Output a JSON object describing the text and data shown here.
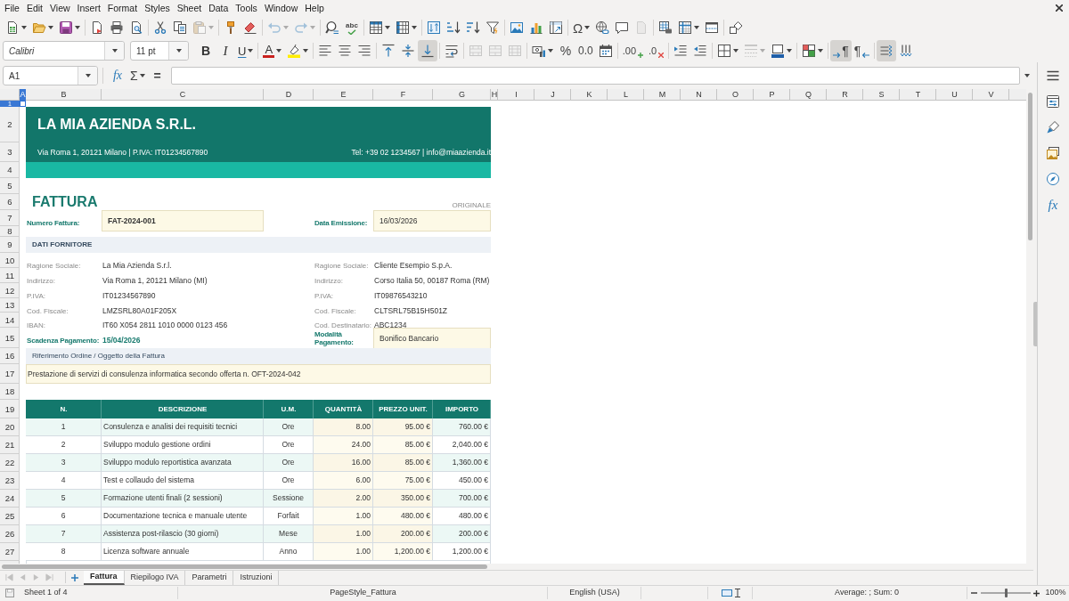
{
  "menu_bar": {
    "items": [
      "File",
      "Edit",
      "View",
      "Insert",
      "Format",
      "Styles",
      "Sheet",
      "Data",
      "Tools",
      "Window",
      "Help"
    ]
  },
  "standard_toolbar": [
    [
      {
        "kind": "new",
        "disabled": false
      },
      {
        "kind": "open",
        "disabled": false
      },
      {
        "kind": "save",
        "disabled": false
      }
    ],
    [
      {
        "kind": "export_pdf",
        "disabled": false
      },
      {
        "kind": "print",
        "disabled": false
      },
      {
        "kind": "print_preview",
        "disabled": false
      }
    ],
    [
      {
        "kind": "cut",
        "disabled": false
      },
      {
        "kind": "copy",
        "disabled": false
      },
      {
        "kind": "paste",
        "disabled": true
      }
    ],
    [
      {
        "kind": "clone_formatting",
        "disabled": false
      },
      {
        "kind": "clear_formatting",
        "disabled": false
      }
    ],
    [
      {
        "kind": "undo",
        "disabled": true
      },
      {
        "kind": "redo",
        "disabled": true
      }
    ],
    [
      {
        "kind": "find_replace",
        "disabled": false
      },
      {
        "kind": "spelling",
        "label": "abc",
        "disabled": false
      }
    ],
    [
      {
        "kind": "rows",
        "disabled": false
      },
      {
        "kind": "columns",
        "disabled": false
      }
    ],
    [
      {
        "kind": "sort",
        "disabled": false
      },
      {
        "kind": "sort_ascending",
        "disabled": false
      },
      {
        "kind": "sort_descending",
        "disabled": false
      },
      {
        "kind": "autofilter",
        "disabled": false
      }
    ],
    [
      {
        "kind": "image",
        "disabled": false
      },
      {
        "kind": "chart",
        "disabled": false
      },
      {
        "kind": "pivot_table",
        "disabled": false
      }
    ],
    [
      {
        "kind": "special_character",
        "label": "Ω",
        "disabled": false
      },
      {
        "kind": "hyperlink",
        "disabled": false
      },
      {
        "kind": "comment",
        "disabled": false
      },
      {
        "kind": "header_footer",
        "disabled": true
      }
    ],
    [
      {
        "kind": "print_area",
        "disabled": false
      },
      {
        "kind": "freeze",
        "disabled": false
      },
      {
        "kind": "split_window",
        "disabled": false
      }
    ],
    [
      {
        "kind": "draw_functions",
        "disabled": false
      }
    ]
  ],
  "formatting_toolbar": {
    "font_name": "Calibri",
    "font_size": "11 pt",
    "groups": [
      [
        {
          "kind": "bold",
          "label": "B",
          "pressed": false,
          "disabled": false
        },
        {
          "kind": "italic",
          "label": "I",
          "pressed": false,
          "disabled": false
        },
        {
          "kind": "underline",
          "label": "U",
          "pressed": false,
          "disabled": false
        }
      ],
      [
        {
          "kind": "font_color",
          "label": "A",
          "pressed": false,
          "disabled": false
        },
        {
          "kind": "highlight",
          "pressed": false,
          "disabled": false
        }
      ],
      [
        {
          "kind": "align_left",
          "pressed": false,
          "disabled": false
        },
        {
          "kind": "align_center",
          "pressed": false,
          "disabled": false
        },
        {
          "kind": "align_right",
          "pressed": false,
          "disabled": false
        }
      ],
      [
        {
          "kind": "align_top",
          "pressed": false,
          "disabled": false
        },
        {
          "kind": "align_middle",
          "pressed": false,
          "disabled": false
        },
        {
          "kind": "align_bottom",
          "pressed": true,
          "disabled": false
        }
      ],
      [
        {
          "kind": "wrap_text",
          "pressed": false,
          "disabled": false
        }
      ],
      [
        {
          "kind": "merge_center",
          "pressed": false,
          "disabled": true
        },
        {
          "kind": "merge",
          "pressed": false,
          "disabled": true
        },
        {
          "kind": "unmerge",
          "pressed": false,
          "disabled": true
        }
      ],
      [
        {
          "kind": "currency",
          "pressed": false,
          "disabled": false
        },
        {
          "kind": "percent",
          "label": "%",
          "pressed": false,
          "disabled": false
        },
        {
          "kind": "number",
          "label": "0.0",
          "pressed": false,
          "disabled": false
        },
        {
          "kind": "date",
          "pressed": false,
          "disabled": false
        }
      ],
      [
        {
          "kind": "add_decimal",
          "label": ".00",
          "pressed": false,
          "disabled": false
        },
        {
          "kind": "delete_decimal",
          "label": ".0",
          "pressed": false,
          "disabled": false
        }
      ],
      [
        {
          "kind": "indent_increase",
          "pressed": false,
          "disabled": false
        },
        {
          "kind": "indent_decrease",
          "pressed": false,
          "disabled": false
        }
      ],
      [
        {
          "kind": "borders",
          "pressed": false,
          "disabled": false
        },
        {
          "kind": "border_style",
          "pressed": false,
          "disabled": true
        },
        {
          "kind": "border_color",
          "pressed": false,
          "disabled": false
        }
      ],
      [
        {
          "kind": "conditional",
          "pressed": false,
          "disabled": false
        }
      ],
      [
        {
          "kind": "ltr",
          "label": "¶",
          "pressed": true,
          "disabled": false
        },
        {
          "kind": "rtl",
          "label": "¶",
          "pressed": false,
          "disabled": false
        }
      ],
      [
        {
          "kind": "text_horizontal",
          "pressed": true,
          "disabled": false
        },
        {
          "kind": "text_vertical",
          "pressed": false,
          "disabled": false
        }
      ]
    ]
  },
  "formula_bar": {
    "name_box": "A1",
    "buttons": [
      {
        "kind": "function_wizard",
        "label": "fx"
      },
      {
        "kind": "sum",
        "label": "Σ"
      },
      {
        "kind": "formula",
        "label": "="
      }
    ]
  },
  "sidebar": {
    "buttons": [
      {
        "kind": "menu"
      },
      {
        "kind": "properties"
      },
      {
        "kind": "styles"
      },
      {
        "kind": "gallery"
      },
      {
        "kind": "navigator"
      },
      {
        "kind": "functions",
        "label": "fx"
      }
    ]
  },
  "sheet": {
    "columns": [
      {
        "label": "A",
        "selected": true
      },
      {
        "label": "B",
        "selected": false
      },
      {
        "label": "C",
        "selected": false
      },
      {
        "label": "D",
        "selected": false
      },
      {
        "label": "E",
        "selected": false
      },
      {
        "label": "F",
        "selected": false
      },
      {
        "label": "G",
        "selected": false
      },
      {
        "label": "H",
        "selected": false
      },
      {
        "label": "I",
        "selected": false
      },
      {
        "label": "J",
        "selected": false
      },
      {
        "label": "K",
        "selected": false
      },
      {
        "label": "L",
        "selected": false
      },
      {
        "label": "M",
        "selected": false
      },
      {
        "label": "N",
        "selected": false
      },
      {
        "label": "O",
        "selected": false
      },
      {
        "label": "P",
        "selected": false
      },
      {
        "label": "Q",
        "selected": false
      },
      {
        "label": "R",
        "selected": false
      },
      {
        "label": "S",
        "selected": false
      },
      {
        "label": "T",
        "selected": false
      },
      {
        "label": "U",
        "selected": false
      },
      {
        "label": "V",
        "selected": false
      }
    ],
    "rows": [
      {
        "label": "1",
        "selected": true
      },
      {
        "label": "2",
        "selected": false
      },
      {
        "label": "3",
        "selected": false
      },
      {
        "label": "4",
        "selected": false
      },
      {
        "label": "5",
        "selected": false
      },
      {
        "label": "6",
        "selected": false
      },
      {
        "label": "7",
        "selected": false
      },
      {
        "label": "8",
        "selected": false
      },
      {
        "label": "9",
        "selected": false
      },
      {
        "label": "10",
        "selected": false
      },
      {
        "label": "11",
        "selected": false
      },
      {
        "label": "12",
        "selected": false
      },
      {
        "label": "13",
        "selected": false
      },
      {
        "label": "14",
        "selected": false
      },
      {
        "label": "15",
        "selected": false
      },
      {
        "label": "16",
        "selected": false
      },
      {
        "label": "17",
        "selected": false
      },
      {
        "label": "18",
        "selected": false
      },
      {
        "label": "19",
        "selected": false
      },
      {
        "label": "20",
        "selected": false
      },
      {
        "label": "21",
        "selected": false
      },
      {
        "label": "22",
        "selected": false
      },
      {
        "label": "23",
        "selected": false
      },
      {
        "label": "24",
        "selected": false
      },
      {
        "label": "25",
        "selected": false
      },
      {
        "label": "26",
        "selected": false
      },
      {
        "label": "27",
        "selected": false
      }
    ],
    "invoice": {
      "company_name": "LA MIA AZIENDA S.R.L.",
      "company_address": "Via Roma 1, 20121 Milano | P.IVA: IT01234567890",
      "company_contact": "Tel: +39 02 1234567 | info@miaazienda.it",
      "title": "FATTURA",
      "copy_type": "ORIGINALE",
      "invoice_number": {
        "label": "Numero Fattura:",
        "value": "FAT-2024-001"
      },
      "issue_date": {
        "label": "Data Emissione:",
        "value": "16/03/2026"
      },
      "supplier_heading": "DATI FORNITORE",
      "supplier": [
        {
          "label": "Ragione Sociale:",
          "value": "La Mia Azienda S.r.l."
        },
        {
          "label": "Indirizzo:",
          "value": "Via Roma 1, 20121 Milano (MI)"
        },
        {
          "label": "P.IVA:",
          "value": "IT01234567890"
        },
        {
          "label": "Cod. Fiscale:",
          "value": "LMZSRL80A01F205X"
        },
        {
          "label": "IBAN:",
          "value": "IT60 X054 2811 1010 0000 0123 456"
        }
      ],
      "client": [
        {
          "label": "Ragione Sociale:",
          "value": "Cliente Esempio S.p.A."
        },
        {
          "label": "Indirizzo:",
          "value": "Corso Italia 50, 00187 Roma (RM)"
        },
        {
          "label": "P.IVA:",
          "value": "IT09876543210"
        },
        {
          "label": "Cod. Fiscale:",
          "value": "CLTSRL75B15H501Z"
        },
        {
          "label": "Cod. Destinatario:",
          "value": "ABC1234"
        }
      ],
      "payment_due": {
        "label": "Scadenza Pagamento:",
        "value": "15/04/2026"
      },
      "payment_method": {
        "label": "Modalità Pagamento:",
        "value": "Bonifico Bancario"
      },
      "reference_heading": "Riferimento Ordine / Oggetto della Fattura",
      "reference": "Prestazione di servizi di consulenza informatica secondo offerta n. OFT-2024-042",
      "items": {
        "columns": [
          "N.",
          "DESCRIZIONE",
          "U.M.",
          "QUANTITÀ",
          "PREZZO UNIT.",
          "IMPORTO"
        ],
        "rows": [
          [
            "1",
            "Consulenza e analisi dei requisiti tecnici",
            "Ore",
            "8.00",
            "95.00 €",
            "760.00 €"
          ],
          [
            "2",
            "Sviluppo modulo gestione ordini",
            "Ore",
            "24.00",
            "85.00 €",
            "2,040.00 €"
          ],
          [
            "3",
            "Sviluppo modulo reportistica avanzata",
            "Ore",
            "16.00",
            "85.00 €",
            "1,360.00 €"
          ],
          [
            "4",
            "Test e collaudo del sistema",
            "Ore",
            "6.00",
            "75.00 €",
            "450.00 €"
          ],
          [
            "5",
            "Formazione utenti finali (2 sessioni)",
            "Sessione",
            "2.00",
            "350.00 €",
            "700.00 €"
          ],
          [
            "6",
            "Documentazione tecnica e manuale utente",
            "Forfait",
            "1.00",
            "480.00 €",
            "480.00 €"
          ],
          [
            "7",
            "Assistenza post-rilascio (30 giorni)",
            "Mese",
            "1.00",
            "200.00 €",
            "200.00 €"
          ],
          [
            "8",
            "Licenza software annuale",
            "Anno",
            "1.00",
            "1,200.00 €",
            "1,200.00 €"
          ]
        ]
      }
    }
  },
  "sheet_navigation": [
    {
      "kind": "first",
      "disabled": true
    },
    {
      "kind": "previous",
      "disabled": true
    },
    {
      "kind": "next",
      "disabled": true
    },
    {
      "kind": "last",
      "disabled": true
    }
  ],
  "sheet_tabs": [
    {
      "label": "Fattura",
      "selected": true
    },
    {
      "label": "Riepilogo IVA",
      "selected": false
    },
    {
      "label": "Parametri",
      "selected": false
    },
    {
      "label": "Istruzioni",
      "selected": false
    }
  ],
  "status_bar": {
    "sheet": "Sheet 1 of 4",
    "page_style": "PageStyle_Fattura",
    "language": "English (USA)",
    "selection_stats": "Average: ; Sum: 0",
    "zoom": {
      "level": 0.5,
      "reading": "100%"
    }
  }
}
